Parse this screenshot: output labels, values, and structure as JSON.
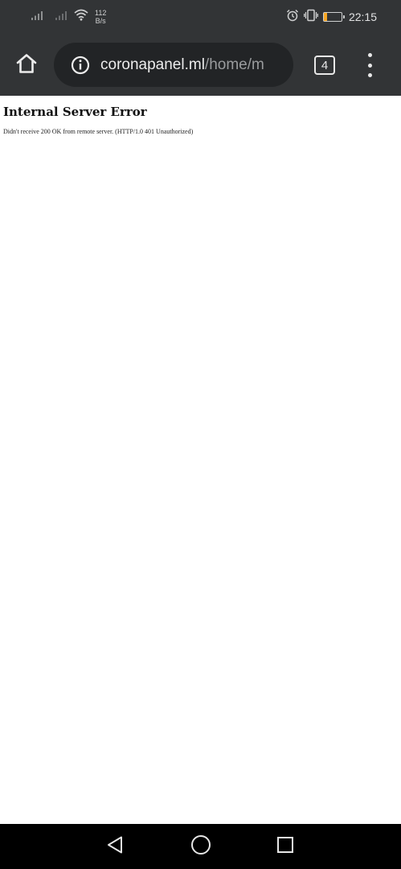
{
  "status_bar": {
    "net_speed_value": "112",
    "net_speed_unit": "B/s",
    "battery_level": "19",
    "time": "22:15",
    "colors": {
      "background": "#323436",
      "battery_accent": "#f6a623"
    }
  },
  "browser": {
    "url_domain": "coronapanel.ml",
    "url_path": "/home/m",
    "tab_count": "4",
    "colors": {
      "toolbar_background": "#323436",
      "url_bar_background": "#222426"
    }
  },
  "page": {
    "title": "Internal Server Error",
    "message": "Didn't receive 200 OK from remote server. (HTTP/1.0 401 Unauthorized)"
  },
  "icons": {
    "status_left": [
      "signal-icon",
      "signal-icon",
      "wifi-icon"
    ],
    "status_right": [
      "alarm-icon",
      "vibrate-icon",
      "battery-icon"
    ],
    "toolbar": [
      "home-icon",
      "info-icon",
      "tabs-icon",
      "more-vert-icon"
    ],
    "navigation": [
      "back-icon",
      "home-circle-icon",
      "recents-icon"
    ]
  }
}
